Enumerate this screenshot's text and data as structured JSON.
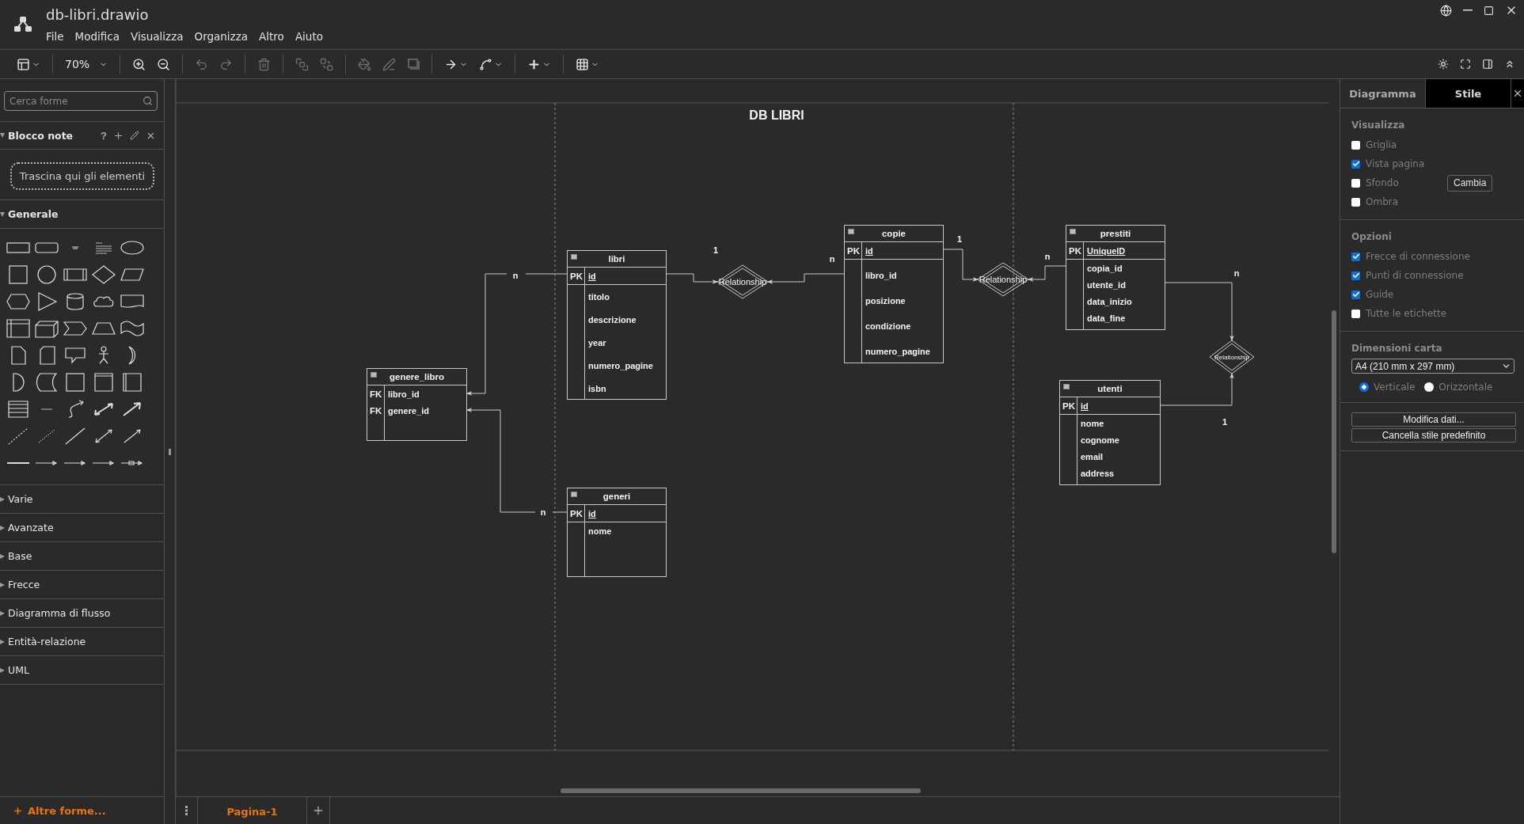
{
  "window": {
    "title": "db-libri.drawio"
  },
  "menu": [
    "File",
    "Modifica",
    "Visualizza",
    "Organizza",
    "Altro",
    "Aiuto"
  ],
  "toolbar": {
    "tools": [
      {
        "kind": "layout",
        "disabled": false
      },
      {
        "kind": "divider"
      },
      {
        "kind": "zoom",
        "label": "70%"
      },
      {
        "kind": "divider"
      },
      {
        "kind": "zoom_in",
        "disabled": false
      },
      {
        "kind": "zoom_out",
        "disabled": false
      },
      {
        "kind": "divider"
      },
      {
        "kind": "undo",
        "disabled": true
      },
      {
        "kind": "redo",
        "disabled": true
      },
      {
        "kind": "divider"
      },
      {
        "kind": "delete",
        "disabled": true
      },
      {
        "kind": "divider"
      },
      {
        "kind": "to_front",
        "disabled": true
      },
      {
        "kind": "to_back",
        "disabled": true
      },
      {
        "kind": "divider"
      },
      {
        "kind": "fill",
        "disabled": true
      },
      {
        "kind": "line",
        "disabled": true
      },
      {
        "kind": "shadow",
        "disabled": true
      },
      {
        "kind": "divider"
      },
      {
        "kind": "connection",
        "disabled": false
      },
      {
        "kind": "waypoint",
        "disabled": false
      },
      {
        "kind": "divider"
      },
      {
        "kind": "insert",
        "disabled": false
      },
      {
        "kind": "divider"
      },
      {
        "kind": "table",
        "disabled": false
      }
    ],
    "right_tools": [
      {
        "kind": "theme",
        "disabled": false
      },
      {
        "kind": "fullscreen",
        "disabled": false
      },
      {
        "kind": "format",
        "disabled": false
      },
      {
        "kind": "collapse",
        "disabled": false
      }
    ]
  },
  "sidebar": {
    "search": {
      "placeholder": "Cerca forme"
    },
    "scratchpad": {
      "title": "Blocco note",
      "expanded": true,
      "help": "?",
      "drop_hint": "Trascina qui gli elementi"
    },
    "libraries": [
      {
        "title": "Generale",
        "expanded": true
      },
      {
        "title": "Varie",
        "expanded": false
      },
      {
        "title": "Avanzate",
        "expanded": false
      },
      {
        "title": "Base",
        "expanded": false
      },
      {
        "title": "Frecce",
        "expanded": false
      },
      {
        "title": "Diagramma di flusso",
        "expanded": false
      },
      {
        "title": "Entità-relazione",
        "expanded": false
      },
      {
        "title": "UML",
        "expanded": false
      }
    ],
    "more_shapes": "Altre forme..."
  },
  "diagram": {
    "title": "DB LIBRI",
    "entities": [
      {
        "name": "libri",
        "rows": [
          {
            "kind": "pk",
            "key": "PK",
            "field": "id"
          },
          {
            "kind": "attr",
            "field": "titolo"
          },
          {
            "kind": "attr",
            "field": "descrizione"
          },
          {
            "kind": "attr",
            "field": "year"
          },
          {
            "kind": "attr",
            "field": "numero_pagine"
          },
          {
            "kind": "attr",
            "field": "isbn"
          }
        ]
      },
      {
        "name": "genere_libro",
        "rows": [
          {
            "kind": "fk",
            "key": "FK",
            "field": "libro_id"
          },
          {
            "kind": "fk",
            "key": "FK",
            "field": "genere_id"
          }
        ]
      },
      {
        "name": "generi",
        "rows": [
          {
            "kind": "pk",
            "key": "PK",
            "field": "id"
          },
          {
            "kind": "attr",
            "field": "nome"
          }
        ]
      },
      {
        "name": "copie",
        "rows": [
          {
            "kind": "pk",
            "key": "PK",
            "field": "id"
          },
          {
            "kind": "attr",
            "field": "libro_id"
          },
          {
            "kind": "attr",
            "field": "posizione"
          },
          {
            "kind": "attr",
            "field": "condizione"
          },
          {
            "kind": "attr",
            "field": "numero_pagine"
          }
        ]
      },
      {
        "name": "prestiti",
        "rows": [
          {
            "kind": "pk",
            "key": "PK",
            "field": "UniqueID"
          },
          {
            "kind": "attr",
            "field": "copia_id"
          },
          {
            "kind": "attr",
            "field": "utente_id"
          },
          {
            "kind": "attr",
            "field": "data_inizio"
          },
          {
            "kind": "attr",
            "field": "data_fine"
          }
        ]
      },
      {
        "name": "utenti",
        "rows": [
          {
            "kind": "pk",
            "key": "PK",
            "field": "id"
          },
          {
            "kind": "attr",
            "field": "nome"
          },
          {
            "kind": "attr",
            "field": "cognome"
          },
          {
            "kind": "attr",
            "field": "email"
          },
          {
            "kind": "attr",
            "field": "address"
          }
        ]
      }
    ],
    "relationships": [
      {
        "label": "Relationship"
      },
      {
        "label": "Relationship"
      },
      {
        "label": "Relationship"
      }
    ],
    "cardinalities": [
      "1",
      "n",
      "1",
      "n",
      "n",
      "1",
      "n",
      "n"
    ]
  },
  "format_panel": {
    "tabs": [
      {
        "label": "Diagramma",
        "selected": true
      },
      {
        "label": "Stile",
        "selected": false
      }
    ],
    "view": {
      "title": "Visualizza",
      "options": [
        {
          "label": "Griglia",
          "checked": false
        },
        {
          "label": "Vista pagina",
          "checked": true
        },
        {
          "label": "Sfondo",
          "checked": false,
          "button": "Cambia"
        },
        {
          "label": "Ombra",
          "checked": false
        }
      ]
    },
    "options": {
      "title": "Opzioni",
      "options": [
        {
          "label": "Frecce di connessione",
          "checked": true
        },
        {
          "label": "Punti di connessione",
          "checked": true
        },
        {
          "label": "Guide",
          "checked": true
        },
        {
          "label": "Tutte le etichette",
          "checked": false
        }
      ]
    },
    "paper": {
      "title": "Dimensioni carta",
      "size": "A4 (210 mm x 297 mm)",
      "orientations": [
        {
          "label": "Verticale",
          "selected": true
        },
        {
          "label": "Orizzontale",
          "selected": false
        }
      ]
    },
    "actions": [
      "Modifica dati...",
      "Cancella stile predefinito"
    ]
  },
  "pages": [
    {
      "label": "Pagina-1",
      "selected": true
    }
  ]
}
